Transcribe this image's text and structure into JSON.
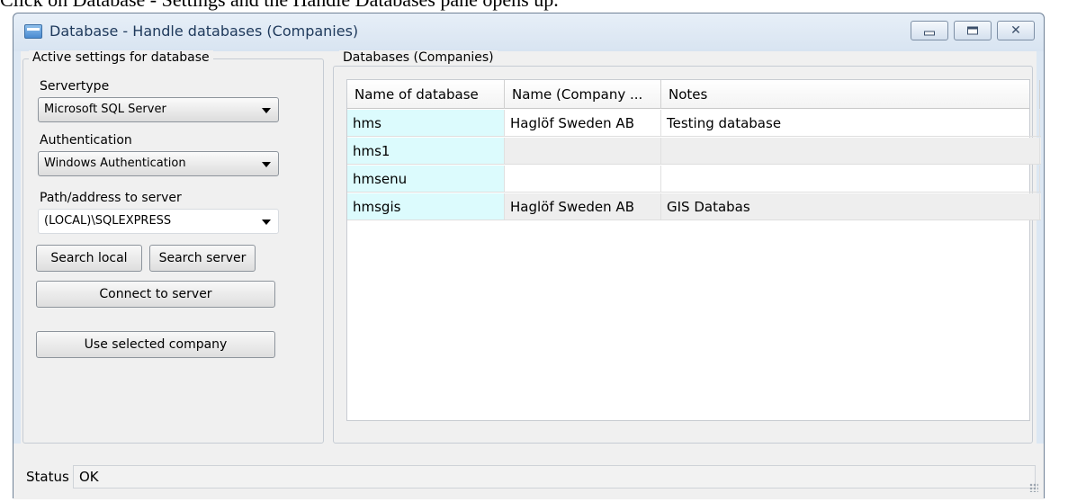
{
  "caption": "Click on Database - Settings and the Handle Databases pane opens up.",
  "window": {
    "title": "Database - Handle databases (Companies)",
    "controls": {
      "minimize_icon": "minimize-icon",
      "maximize_icon": "maximize-icon",
      "close_icon": "close-icon",
      "close_glyph": "✕"
    }
  },
  "left_group": {
    "legend": "Active settings for database",
    "servertype_label": "Servertype",
    "servertype_value": "Microsoft SQL Server",
    "authentication_label": "Authentication",
    "authentication_value": "Windows Authentication",
    "path_label": "Path/address to server",
    "path_value": "(LOCAL)\\SQLEXPRESS",
    "search_local": "Search local",
    "search_server": "Search server",
    "connect": "Connect to server",
    "use_selected": "Use selected company"
  },
  "right_group": {
    "legend": "Databases (Companies)",
    "columns": [
      "Name of database",
      "Name (Company ...",
      "Notes"
    ],
    "rows": [
      [
        "hms",
        "Haglöf Sweden AB",
        "Testing database"
      ],
      [
        "hms1",
        "",
        ""
      ],
      [
        "hmsenu",
        "",
        ""
      ],
      [
        "hmsgis",
        "Haglöf Sweden AB",
        "GIS Databas"
      ]
    ]
  },
  "status": {
    "label": "Status",
    "value": "OK"
  }
}
